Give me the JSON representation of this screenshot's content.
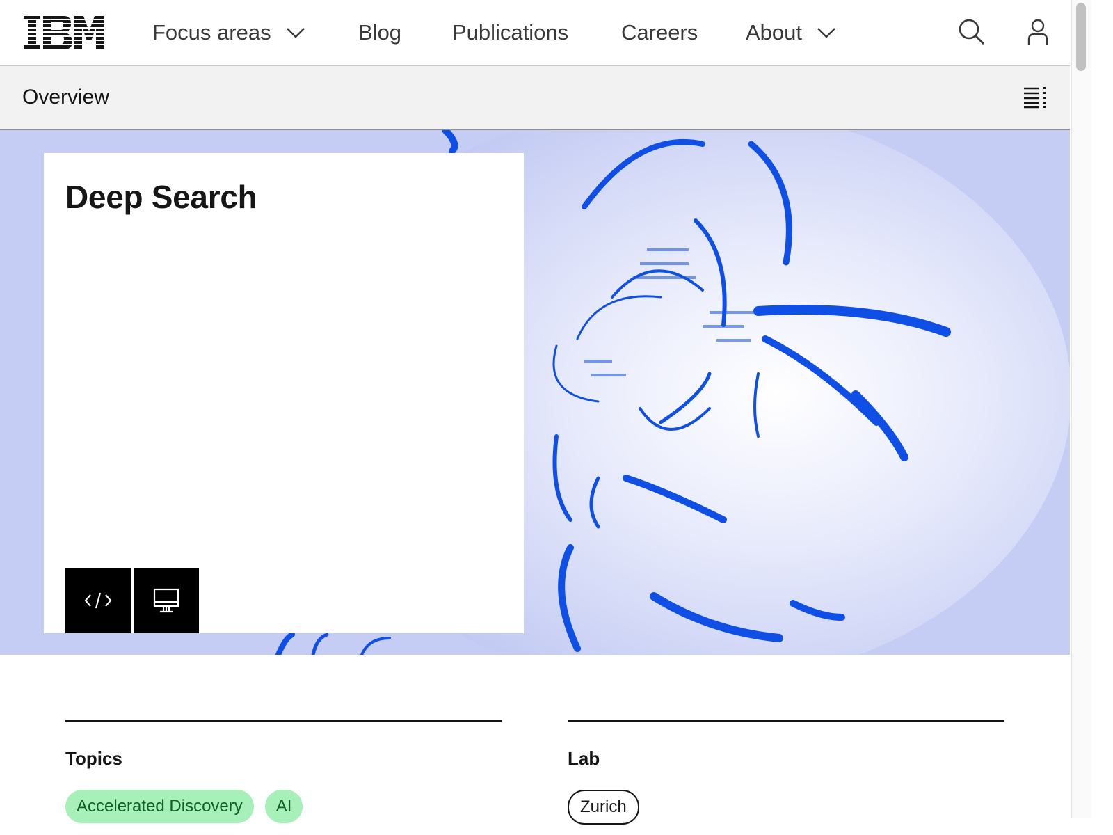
{
  "brand": {
    "logo_text": "IBM"
  },
  "nav": {
    "items": [
      {
        "label": "Focus areas",
        "has_dropdown": true
      },
      {
        "label": "Blog",
        "has_dropdown": false
      },
      {
        "label": "Publications",
        "has_dropdown": false
      },
      {
        "label": "Careers",
        "has_dropdown": false
      },
      {
        "label": "About",
        "has_dropdown": true
      }
    ],
    "icons": [
      "search-icon",
      "user-icon"
    ]
  },
  "subnav": {
    "title": "Overview",
    "icon": "table-of-contents-icon"
  },
  "hero": {
    "title": "Deep Search",
    "buttons": [
      "code-icon",
      "desktop-icon"
    ],
    "background_colors": [
      "#c6cdf4",
      "#0f4fe6"
    ]
  },
  "meta": {
    "topics": {
      "heading": "Topics",
      "tags": [
        "Accelerated Discovery",
        "AI"
      ]
    },
    "lab": {
      "heading": "Lab",
      "tags": [
        "Zurich"
      ]
    }
  },
  "colors": {
    "tag_green_bg": "#a7f0ba",
    "tag_green_text": "#0e6027",
    "text": "#161616"
  }
}
